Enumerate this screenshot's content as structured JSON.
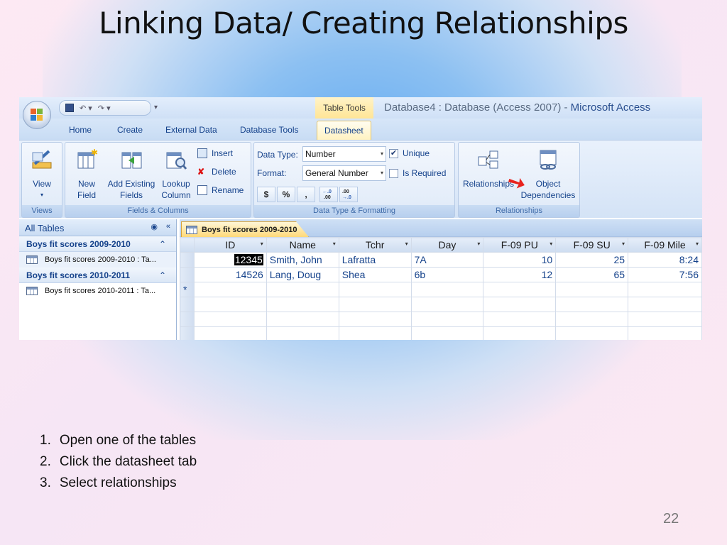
{
  "slide": {
    "title": "Linking Data/ Creating Relationships",
    "page_number": "22",
    "steps": [
      {
        "num": "1.",
        "text": "Open one of the tables"
      },
      {
        "num": "2.",
        "text": "Click the datasheet tab"
      },
      {
        "num": "3.",
        "text": "Select relationships"
      }
    ]
  },
  "window": {
    "context_tab": "Table Tools",
    "title_prefix": "Database4 : Database (Access 2007) -",
    "app_name": "Microsoft Access"
  },
  "tabs": [
    "Home",
    "Create",
    "External Data",
    "Database Tools",
    "Datasheet"
  ],
  "ribbon": {
    "views": {
      "label": "Views",
      "view_button": "View"
    },
    "fields_columns": {
      "label": "Fields & Columns",
      "new_field": [
        "New",
        "Field"
      ],
      "add_existing": [
        "Add Existing",
        "Fields"
      ],
      "lookup": [
        "Lookup",
        "Column"
      ],
      "insert": "Insert",
      "delete": "Delete",
      "rename": "Rename"
    },
    "data_type_formatting": {
      "label": "Data Type & Formatting",
      "data_type_label": "Data Type:",
      "data_type_value": "Number",
      "format_label": "Format:",
      "format_value": "General Number",
      "unique_label": "Unique",
      "unique_checked": true,
      "required_label": "Is Required",
      "currency": "$",
      "percent": "%",
      "comma": ","
    },
    "relationships": {
      "label": "Relationships",
      "relationships_button": "Relationships",
      "object_dependencies": [
        "Object",
        "Dependencies"
      ]
    }
  },
  "nav_pane": {
    "header": "All Tables",
    "groups": [
      {
        "title": "Boys fit scores 2009-2010",
        "item": "Boys fit scores 2009-2010 : Ta..."
      },
      {
        "title": "Boys fit scores 2010-2011",
        "item": "Boys fit scores 2010-2011 : Ta..."
      }
    ]
  },
  "datasheet": {
    "tab_title": "Boys fit scores 2009-2010",
    "columns": [
      "ID",
      "Name",
      "Tchr",
      "Day",
      "F-09 PU",
      "F-09 SU",
      "F-09 Mile"
    ],
    "rows": [
      [
        "12345",
        "Smith, John",
        "Lafratta",
        "7A",
        "10",
        "25",
        "8:24"
      ],
      [
        "14526",
        "Lang, Doug",
        "Shea",
        "6b",
        "12",
        "65",
        "7:56"
      ]
    ],
    "new_row_marker": "*"
  },
  "colors": {
    "accent_red": "#e8231e",
    "ribbon_blue": "#15428b",
    "active_tab": "#ffd97a"
  }
}
